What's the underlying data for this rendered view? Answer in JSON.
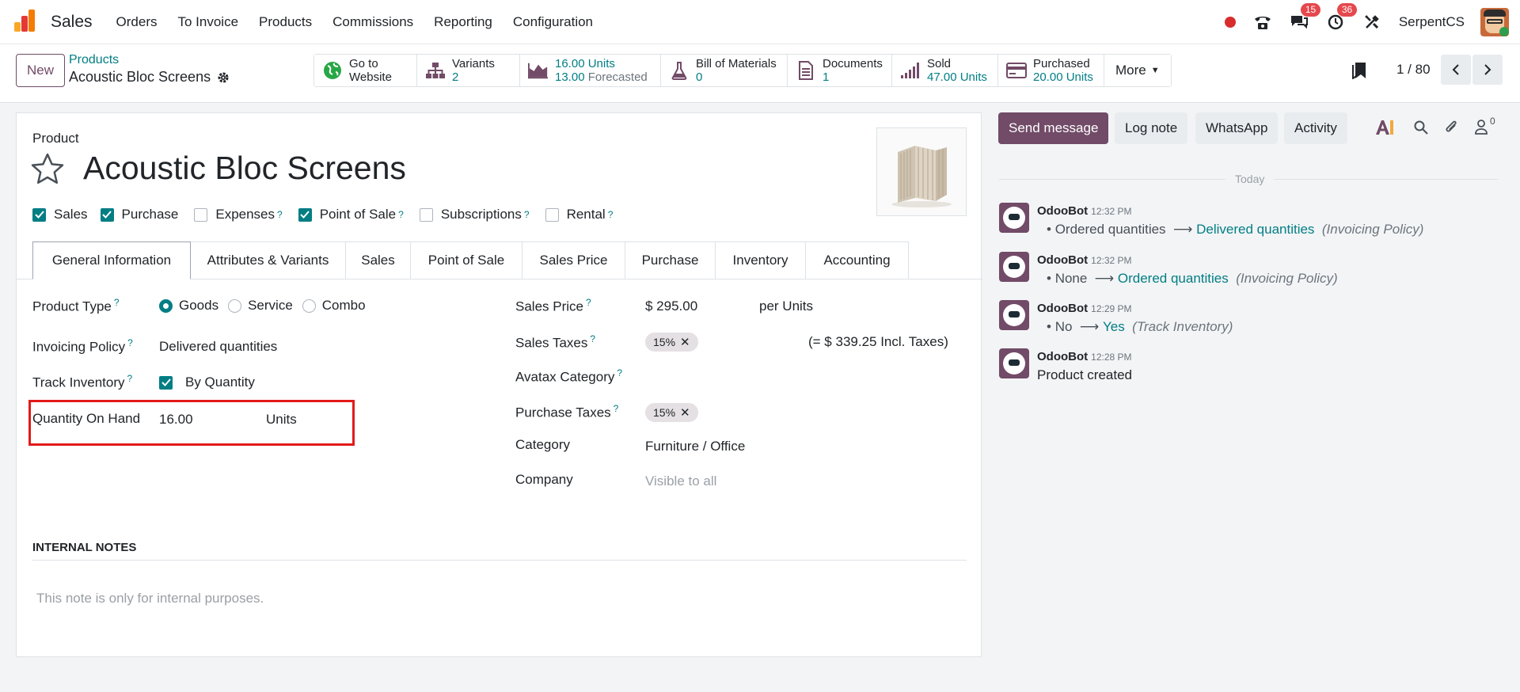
{
  "navbar": {
    "app_name": "Sales",
    "menu": [
      "Orders",
      "To Invoice",
      "Products",
      "Commissions",
      "Reporting",
      "Configuration"
    ],
    "messages_count": "15",
    "activities_count": "36",
    "company": "SerpentCS"
  },
  "control": {
    "new_label": "New",
    "breadcrumb_parent": "Products",
    "breadcrumb_current": "Acoustic Bloc Screens",
    "smart_buttons": {
      "website": {
        "line1": "Go to",
        "line2": "Website"
      },
      "variants": {
        "label": "Variants",
        "value": "2"
      },
      "forecast": {
        "units": "16.00 Units",
        "forecasted_value": "13.00",
        "forecasted_label": "Forecasted"
      },
      "bom": {
        "label": "Bill of Materials",
        "value": "0"
      },
      "documents": {
        "label": "Documents",
        "value": "1"
      },
      "sold": {
        "label": "Sold",
        "value": "47.00 Units"
      },
      "purchased": {
        "label": "Purchased",
        "value": "20.00 Units"
      },
      "more": "More"
    },
    "pager": "1 / 80"
  },
  "form": {
    "type_label": "Product",
    "name": "Acoustic Bloc Screens",
    "checkboxes": [
      {
        "label": "Sales",
        "checked": true,
        "help": false
      },
      {
        "label": "Purchase",
        "checked": true,
        "help": false
      },
      {
        "label": "Expenses",
        "checked": false,
        "help": true
      },
      {
        "label": "Point of Sale",
        "checked": true,
        "help": true
      },
      {
        "label": "Subscriptions",
        "checked": false,
        "help": true
      },
      {
        "label": "Rental",
        "checked": false,
        "help": true
      }
    ],
    "help_mark": "?",
    "tabs": [
      "General Information",
      "Attributes & Variants",
      "Sales",
      "Point of Sale",
      "Sales Price",
      "Purchase",
      "Inventory",
      "Accounting"
    ],
    "left": {
      "product_type_label": "Product Type",
      "product_type_options": [
        "Goods",
        "Service",
        "Combo"
      ],
      "invoicing_policy_label": "Invoicing Policy",
      "invoicing_policy_value": "Delivered quantities",
      "track_inventory_label": "Track Inventory",
      "track_inventory_value": "By Quantity",
      "qty_on_hand_label": "Quantity On Hand",
      "qty_on_hand_value": "16.00",
      "qty_on_hand_unit": "Units"
    },
    "right": {
      "sales_price_label": "Sales Price",
      "sales_price_value": "$ 295.00",
      "sales_price_unit": "per Units",
      "sales_taxes_label": "Sales Taxes",
      "sales_taxes_tag": "15%",
      "sales_taxes_incl": "(= $ 339.25 Incl. Taxes)",
      "avatax_label": "Avatax Category",
      "purchase_taxes_label": "Purchase Taxes",
      "purchase_taxes_tag": "15%",
      "category_label": "Category",
      "category_value": "Furniture / Office",
      "company_label": "Company",
      "company_placeholder": "Visible to all"
    },
    "internal_notes_title": "INTERNAL NOTES",
    "internal_notes_placeholder": "This note is only for internal purposes."
  },
  "chatter": {
    "send_message": "Send message",
    "log_note": "Log note",
    "whatsapp": "WhatsApp",
    "activity": "Activity",
    "followers_count": "0",
    "date_separator": "Today",
    "messages": [
      {
        "author": "OdooBot",
        "time": "12:32 PM",
        "old": "Ordered quantities",
        "new": "Delivered quantities",
        "field": "(Invoicing Policy)"
      },
      {
        "author": "OdooBot",
        "time": "12:32 PM",
        "old": "None",
        "new": "Ordered quantities",
        "field": "(Invoicing Policy)"
      },
      {
        "author": "OdooBot",
        "time": "12:29 PM",
        "old": "No",
        "new": "Yes",
        "field": "(Track Inventory)"
      },
      {
        "author": "OdooBot",
        "time": "12:28 PM",
        "body": "Product created"
      }
    ]
  },
  "colors": {
    "brand": "#714b67",
    "accent": "#017e84",
    "highlight": "#e21a1a"
  }
}
